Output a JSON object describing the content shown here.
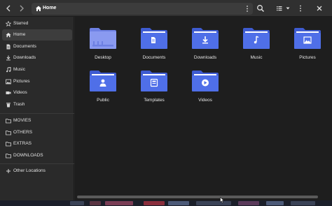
{
  "window": {
    "location": "Home"
  },
  "headerbar": {
    "back_icon": "chevron-left-icon",
    "forward_icon": "chevron-right-icon",
    "path_icon": "home-icon",
    "path_menu_icon": "vertical-dots-icon",
    "search_icon": "search-icon",
    "view_icon": "list-view-icon",
    "view_dropdown_icon": "chevron-down-icon",
    "menu_icon": "vertical-dots-icon",
    "close_icon": "close-icon"
  },
  "sidebar": {
    "places": [
      {
        "label": "Starred",
        "icon": "star-icon"
      },
      {
        "label": "Home",
        "icon": "home-icon",
        "active": true
      },
      {
        "label": "Documents",
        "icon": "document-icon"
      },
      {
        "label": "Downloads",
        "icon": "download-icon"
      },
      {
        "label": "Music",
        "icon": "music-icon"
      },
      {
        "label": "Pictures",
        "icon": "picture-icon"
      },
      {
        "label": "Videos",
        "icon": "video-icon"
      },
      {
        "label": "Trash",
        "icon": "trash-icon"
      }
    ],
    "bookmarks": [
      {
        "label": "MOVIES",
        "icon": "folder-icon"
      },
      {
        "label": "OTHERS",
        "icon": "folder-icon"
      },
      {
        "label": "EXTRAS",
        "icon": "folder-icon"
      },
      {
        "label": "DOWNLOADS",
        "icon": "folder-icon"
      }
    ],
    "other": {
      "label": "Other Locations",
      "icon": "plus-icon"
    }
  },
  "files": [
    {
      "name": "Desktop",
      "icon": "desktop-folder-icon"
    },
    {
      "name": "Documents",
      "icon": "documents-folder-icon"
    },
    {
      "name": "Downloads",
      "icon": "downloads-folder-icon"
    },
    {
      "name": "Music",
      "icon": "music-folder-icon"
    },
    {
      "name": "Pictures",
      "icon": "pictures-folder-icon"
    },
    {
      "name": "Public",
      "icon": "public-folder-icon"
    },
    {
      "name": "Templates",
      "icon": "templates-folder-icon"
    },
    {
      "name": "Videos",
      "icon": "videos-folder-icon"
    }
  ],
  "colors": {
    "folder_blue": "#4f6fe8",
    "folder_blue_dark": "#3e5bd0",
    "folder_desktop": "#8294ef"
  }
}
